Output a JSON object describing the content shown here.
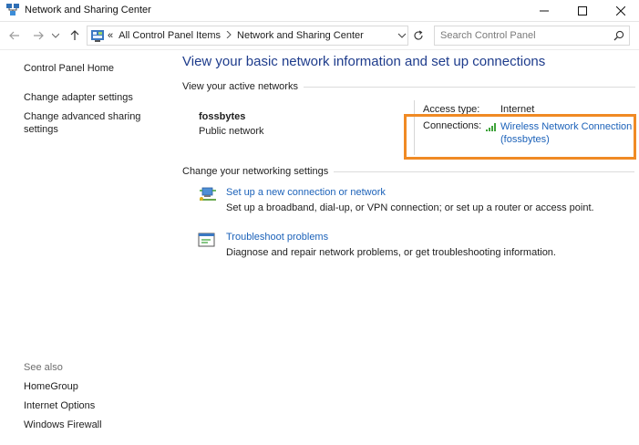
{
  "window": {
    "title": "Network and Sharing Center"
  },
  "address": {
    "crumb_prefix": "«",
    "crumbs": [
      "All Control Panel Items",
      "Network and Sharing Center"
    ],
    "search_placeholder": "Search Control Panel"
  },
  "sidebar": {
    "home": "Control Panel Home",
    "links": [
      "Change adapter settings",
      "Change advanced sharing settings"
    ],
    "see_also_label": "See also",
    "see_also": [
      "HomeGroup",
      "Internet Options",
      "Windows Firewall"
    ]
  },
  "main": {
    "title": "View your basic network information and set up connections",
    "active_networks_header": "View your active networks",
    "network": {
      "name": "fossbytes",
      "type": "Public network",
      "access_type_label": "Access type:",
      "access_type_value": "Internet",
      "connections_label": "Connections:",
      "connection_link": "Wireless Network Connection (fossbytes)"
    },
    "change_settings_header": "Change your networking settings",
    "tasks": [
      {
        "link": "Set up a new connection or network",
        "desc": "Set up a broadband, dial-up, or VPN connection; or set up a router or access point.",
        "icon": "new-connection-icon"
      },
      {
        "link": "Troubleshoot problems",
        "desc": "Diagnose and repair network problems, or get troubleshooting information.",
        "icon": "troubleshoot-icon"
      }
    ]
  },
  "colors": {
    "title_blue": "#1e3c8c",
    "link_blue": "#1c62b9",
    "highlight_orange": "#f08a24"
  }
}
